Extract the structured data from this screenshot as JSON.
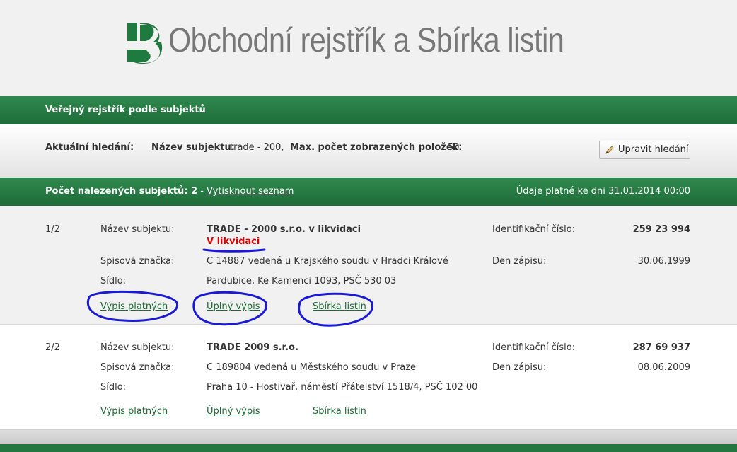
{
  "header": {
    "title": "Obchodní rejstřík a Sbírka listin"
  },
  "section_title": "Veřejný rejstřík podle subjektů",
  "search": {
    "current_label": "Aktuální hledání:",
    "name_label": "Název subjektu:",
    "name_value": "trade - 200,",
    "max_label": "Max. počet zobrazených položek:",
    "max_value": "50",
    "edit_button": "Upravit hledání"
  },
  "results": {
    "count_label": "Počet nalezených subjektů: 2",
    "separator": " - ",
    "print_link": "Vytisknout seznam",
    "valid_date": "Údaje platné ke dni 31.01.2014 00:00"
  },
  "items": [
    {
      "index": "1/2",
      "name_label": "Název subjektu:",
      "name": "TRADE - 2000 s.r.o. v likvidaci",
      "status": "V likvidaci",
      "file_label": "Spisová značka:",
      "file": "C 14887 vedená u Krajského soudu v Hradci Králové",
      "seat_label": "Sídlo:",
      "seat": "Pardubice, Ke Kamenci 1093, PSČ 530 03",
      "id_label": "Identifikační číslo:",
      "id": "259 23 994",
      "date_label": "Den zápisu:",
      "date": "30.06.1999",
      "links": [
        "Výpis platných",
        "Úplný výpis",
        "Sbírka listin"
      ]
    },
    {
      "index": "2/2",
      "name_label": "Název subjektu:",
      "name": "TRADE 2009 s.r.o.",
      "file_label": "Spisová značka:",
      "file": "C 189804 vedená u Městského soudu v Praze",
      "seat_label": "Sídlo:",
      "seat": "Praha 10 - Hostivař, náměstí Přátelství 1518/4, PSČ 102 00",
      "id_label": "Identifikační číslo:",
      "id": "287 69 937",
      "date_label": "Den zápisu:",
      "date": "08.06.2009",
      "links": [
        "Výpis platných",
        "Úplný výpis",
        "Sbírka listin"
      ]
    }
  ],
  "colors": {
    "brand_green": "#1e6b37",
    "link_green": "#1c6a34",
    "status_red": "#e00000",
    "annotation_blue": "#1a1ad6"
  },
  "icons": {
    "logo": "s-logo-icon",
    "edit": "pencil-icon"
  }
}
